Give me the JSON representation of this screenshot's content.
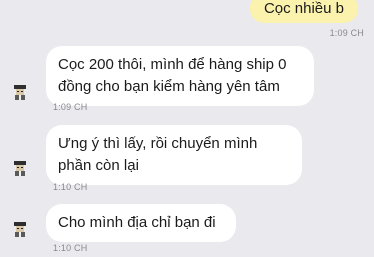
{
  "messages": [
    {
      "direction": "outgoing",
      "text": "Cọc nhiều b",
      "time": "1:09 CH"
    },
    {
      "direction": "incoming",
      "text": "Cọc 200 thôi, mình để hàng ship 0 đồng cho bạn kiểm hàng yên tâm",
      "time": "1:09 CH",
      "avatar_icon": "sender-avatar-icon"
    },
    {
      "direction": "incoming",
      "text": "Ưng ý thì lấy, rồi chuyển mình phần còn lại",
      "time": "1:10 CH",
      "avatar_icon": "sender-avatar-icon"
    },
    {
      "direction": "incoming",
      "text": "Cho mình địa chỉ bạn đi",
      "time": "1:10 CH",
      "avatar_icon": "sender-avatar-icon"
    }
  ],
  "colors": {
    "background": "#e9e9ee",
    "outgoing_bubble": "#fbf2ad",
    "incoming_bubble": "#ffffff",
    "timestamp": "#8a8a8e"
  }
}
